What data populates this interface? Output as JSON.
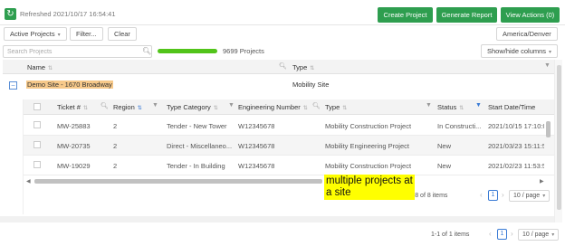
{
  "top": {
    "refreshed": "Refreshed 2021/10/17 16:54:41",
    "create_project": "Create Project",
    "generate_report": "Generate Report",
    "view_actions": "View Actions (0)"
  },
  "filters": {
    "active_projects": "Active Projects",
    "filter": "Filter...",
    "clear": "Clear",
    "timezone": "America/Denver",
    "show_hide": "Show/hide columns"
  },
  "search": {
    "placeholder": "Search Projects",
    "count": "9699 Projects",
    "progress_fraction": 1.0
  },
  "outer_table": {
    "headers": {
      "name": "Name",
      "type": "Type"
    },
    "row": {
      "name": "Demo Site - 1670 Broadway",
      "type": "Mobility Site"
    }
  },
  "nested_table": {
    "headers": {
      "ticket": "Ticket #",
      "region": "Region",
      "type_category": "Type Category",
      "engineering_number": "Engineering Number",
      "type": "Type",
      "status": "Status",
      "start_date": "Start Date/Time"
    },
    "rows": [
      {
        "ticket": "MW-25883",
        "region": "2",
        "type_category": "Tender - New Tower",
        "engineering_number": "W12345678",
        "type": "Mobility Construction Project",
        "status": "In Constructi...",
        "start_date": "2021/10/15 17:10:0"
      },
      {
        "ticket": "MW-20735",
        "region": "2",
        "type_category": "Direct - Miscellaneo...",
        "engineering_number": "W12345678",
        "type": "Mobility Engineering Project",
        "status": "New",
        "start_date": "2021/03/23 15:11:5"
      },
      {
        "ticket": "MW-19029",
        "region": "2",
        "type_category": "Tender - In Building",
        "engineering_number": "W12345678",
        "type": "Mobility Construction Project",
        "status": "New",
        "start_date": "2021/02/23 11:53:5"
      }
    ],
    "pagination": {
      "summary": "1-8 of 8 items",
      "page": "1",
      "page_size": "10 / page"
    }
  },
  "annotation": {
    "text": "multiple projects at a site"
  },
  "outer_pagination": {
    "summary": "1-1 of 1 items",
    "page": "1",
    "page_size": "10 / page"
  },
  "colors": {
    "primary_green": "#2e9e4f",
    "site_highlight": "#f7c98a",
    "annotation_yellow": "#ffff00",
    "progress": "#52c41a"
  }
}
